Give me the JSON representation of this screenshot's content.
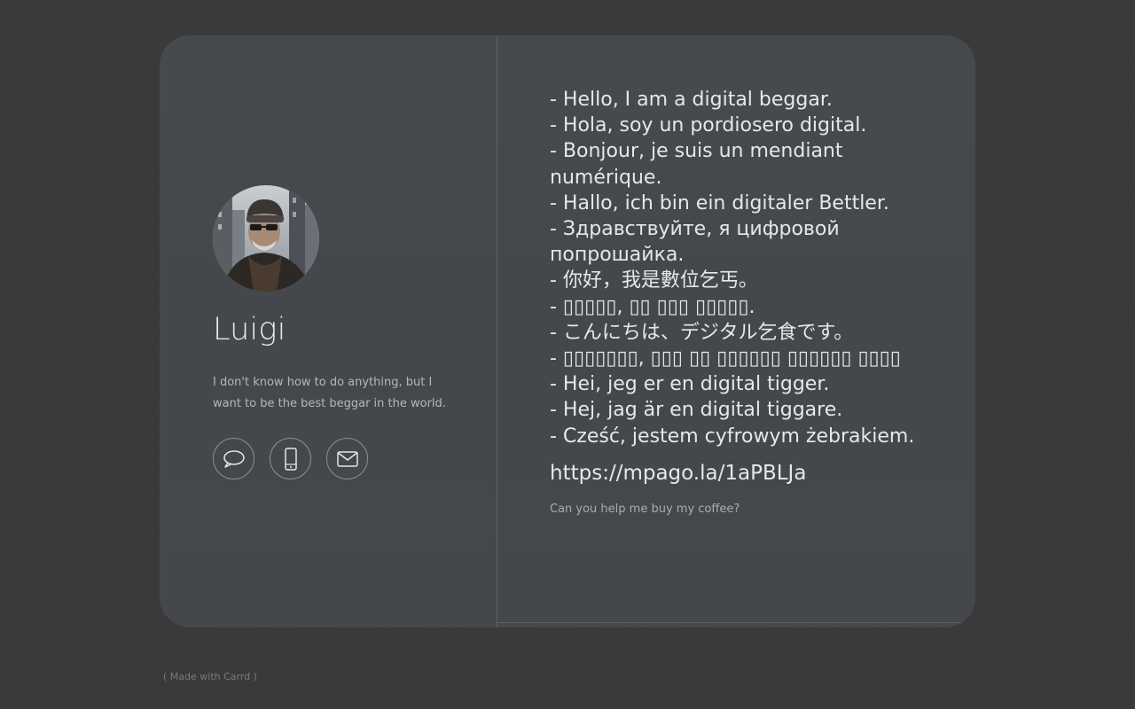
{
  "profile": {
    "name": "Luigi",
    "bio": "I don't know how to do anything, but I want to be the best beggar in the world."
  },
  "contact_icons": [
    "chat-icon",
    "phone-icon",
    "mail-icon"
  ],
  "greetings": [
    "- Hello, I am a digital beggar.",
    "- Hola, soy un pordiosero digital.",
    "- Bonjour, je suis un mendiant numérique.",
    "- Hallo, ich bin ein digitaler Bettler.",
    "- Здравствуйте, я цифровой попрошайка.",
    "- 你好，我是數位乞丐。",
    "- ▯▯▯▯▯, ▯▯ ▯▯▯ ▯▯▯▯▯.",
    "- こんにちは、デジタル乞食です。",
    "- ▯▯▯▯▯▯▯, ▯▯▯ ▯▯ ▯▯▯▯▯▯ ▯▯▯▯▯▯ ▯▯▯▯",
    "- Hei, jeg er en digital tigger.",
    "- Hej, jag är en digital tiggare.",
    "- Cześć, jestem cyfrowym żebrakiem."
  ],
  "payment_link": "https://mpago.la/1aPBLJa",
  "caption": "Can you help me buy my coffee?",
  "footer": "( Made with Carrd )"
}
